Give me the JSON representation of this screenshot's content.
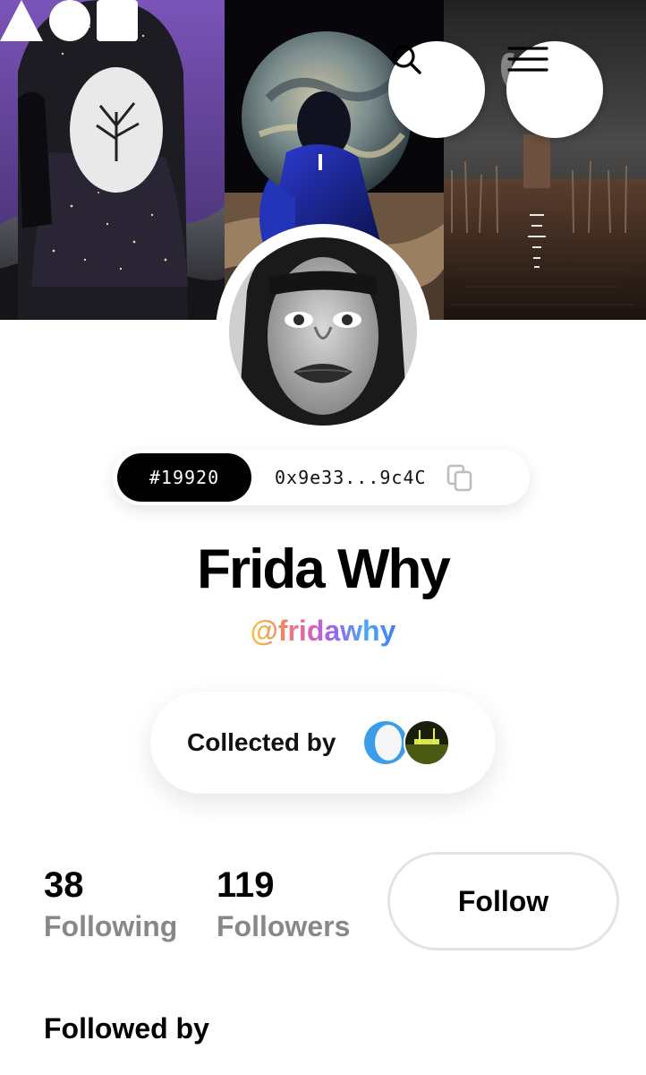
{
  "header": {
    "logo_icon": "aoi-logo-triangle-circle-square",
    "search_icon": "search-icon",
    "menu_icon": "hamburger-menu-icon"
  },
  "profile": {
    "token_id": "#19920",
    "wallet_address": "0x9e33...9c4C",
    "display_name": "Frida Why",
    "handle": "@fridawhy"
  },
  "collected": {
    "label": "Collected by"
  },
  "stats": {
    "following_count": "38",
    "following_label": "Following",
    "followers_count": "119",
    "followers_label": "Followers"
  },
  "actions": {
    "follow_label": "Follow"
  },
  "sections": {
    "followed_by_title": "Followed by"
  },
  "colors": {
    "accent_dark": "#000000",
    "muted_text": "#888888",
    "handle_gradient": [
      "#f4c542",
      "#e25fb3",
      "#8f6bf0",
      "#4a7cf0"
    ]
  }
}
